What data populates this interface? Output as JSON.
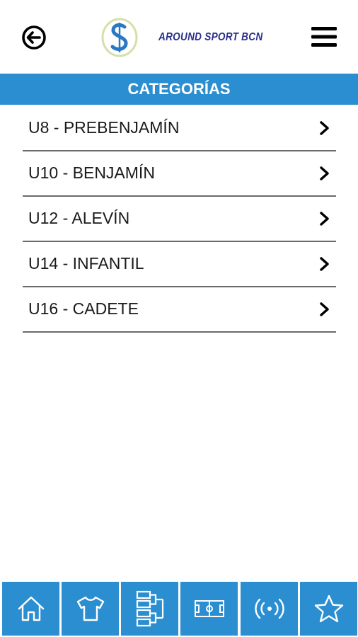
{
  "header": {
    "back_icon": "arrow-left-circle-icon",
    "brand_name": "AROUND SPORT BCN",
    "logo_icon": "s-logo-icon",
    "menu_icon": "hamburger-menu-icon"
  },
  "section": {
    "title": "CATEGORÍAS"
  },
  "categories": [
    {
      "label": "U8 - PREBENJAMÍN"
    },
    {
      "label": "U10 - BENJAMÍN"
    },
    {
      "label": "U12 - ALEVÍN"
    },
    {
      "label": "U14 - INFANTIL"
    },
    {
      "label": "U16 - CADETE"
    }
  ],
  "bottom_nav": [
    {
      "icon": "home-icon"
    },
    {
      "icon": "shirt-icon"
    },
    {
      "icon": "bracket-icon"
    },
    {
      "icon": "field-icon"
    },
    {
      "icon": "broadcast-icon"
    },
    {
      "icon": "star-icon"
    }
  ],
  "colors": {
    "accent": "#2b8ed0",
    "brand_text": "#2b2f8a",
    "logo_green": "#c9d89a",
    "logo_blue": "#2a78c4",
    "divider": "#6b6b6b"
  }
}
